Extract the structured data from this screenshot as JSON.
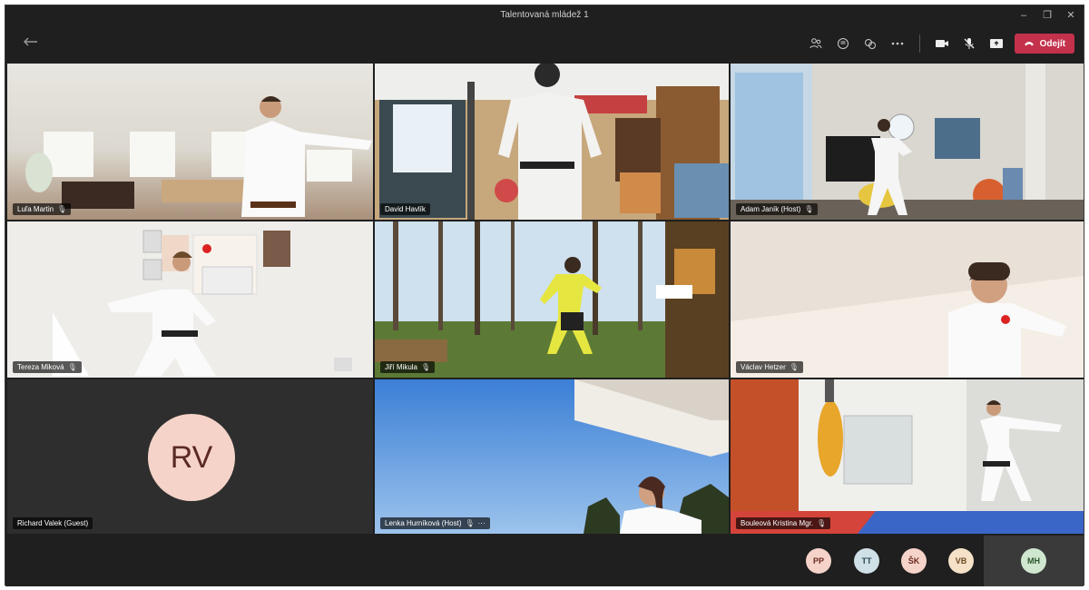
{
  "window": {
    "title": "Talentovaná mládež 1",
    "controls": [
      "–",
      "❐",
      "✕"
    ]
  },
  "toolbar": {
    "back_icon": "arrow-left-icon",
    "icons": [
      "people-icon",
      "chat-icon",
      "reactions-icon",
      "more-icon",
      "camera-icon",
      "mic-off-icon",
      "share-icon"
    ],
    "leave_label": "Odejít",
    "leave_color": "#c4314b"
  },
  "tiles": [
    {
      "name": "Luľa Martin",
      "muted": true
    },
    {
      "name": "David Havlík",
      "muted": false
    },
    {
      "name": "Adam Janík (Host)",
      "muted": true
    },
    {
      "name": "Tereza Miková",
      "muted": true
    },
    {
      "name": "Jiří Mikula",
      "muted": true
    },
    {
      "name": "Václav Hetzer",
      "muted": true
    },
    {
      "name": "Richard Valek (Guest)",
      "muted": false,
      "initials": "RV"
    },
    {
      "name": "Lenka Hurníková (Host)",
      "muted": true,
      "extra": "···"
    },
    {
      "name": "Bouleová Kristina Mgr.",
      "muted": true
    }
  ],
  "participants": [
    {
      "initials": "PP",
      "bg": "#f5d3c9",
      "fg": "#6b2a1f"
    },
    {
      "initials": "TT",
      "bg": "#cfe0e6",
      "fg": "#2a4a55"
    },
    {
      "initials": "ŠK",
      "bg": "#f5d3c9",
      "fg": "#6b2a1f"
    },
    {
      "initials": "VB",
      "bg": "#f5e0c8",
      "fg": "#6b4a1f"
    },
    {
      "initials": "MH",
      "bg": "#cfe6cf",
      "fg": "#2a552a"
    }
  ],
  "mic_icon": "🎙"
}
